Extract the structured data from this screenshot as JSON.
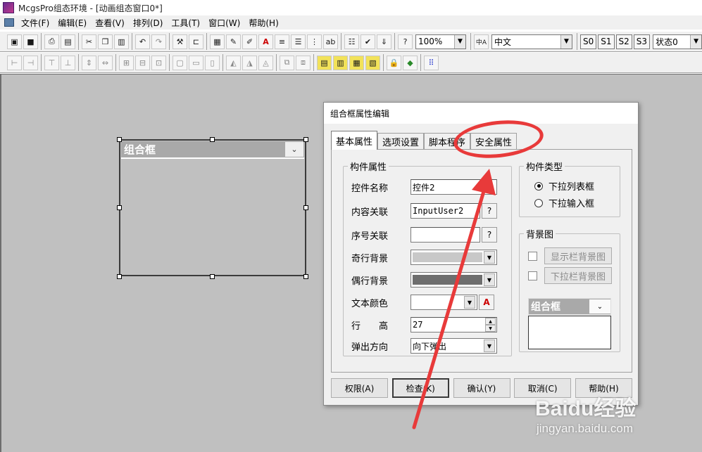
{
  "window": {
    "title": "McgsPro组态环境 - [动画组态窗口0*]"
  },
  "menu": [
    "文件(F)",
    "编辑(E)",
    "查看(V)",
    "排列(D)",
    "工具(T)",
    "窗口(W)",
    "帮助(H)"
  ],
  "toolbar": {
    "zoom_value": "100%",
    "language_value": "中文",
    "language_icon_text": "中A",
    "state_buttons": [
      "S0",
      "S1",
      "S2",
      "S3"
    ],
    "state_value": "状态0",
    "text_icon": "A"
  },
  "canvas_combo": {
    "label": "组合框"
  },
  "dialog": {
    "title": "组合框属性编辑",
    "tabs": [
      "基本属性",
      "选项设置",
      "脚本程序",
      "安全属性"
    ],
    "component_group": {
      "legend": "构件属性",
      "fields": {
        "name": {
          "label": "控件名称",
          "value": "控件2"
        },
        "content": {
          "label": "内容关联",
          "value": "InputUser2",
          "button": "?"
        },
        "index": {
          "label": "序号关联",
          "value": "",
          "button": "?"
        },
        "odd_bg": {
          "label": "奇行背景"
        },
        "even_bg": {
          "label": "偶行背景"
        },
        "text_color": {
          "label": "文本颜色"
        },
        "row_height": {
          "label": "行　　高",
          "value": "27"
        },
        "popup_dir": {
          "label": "弹出方向",
          "value": "向下弹出"
        }
      }
    },
    "type_group": {
      "legend": "构件类型",
      "options": [
        "下拉列表框",
        "下拉输入框"
      ],
      "selected": 0
    },
    "bg_group": {
      "legend": "背景图",
      "checks": [
        "显示栏背景图",
        "下拉栏背景图"
      ],
      "preview_label": "组合框"
    },
    "buttons": [
      "权限(A)",
      "检查(K)",
      "确认(Y)",
      "取消(C)",
      "帮助(H)"
    ]
  },
  "colors": {
    "odd_bg": "#c8c8c8",
    "even_bg": "#6e6e6e",
    "annotation": "#e83a3a"
  },
  "watermark": {
    "brand": "Baidu经验",
    "url": "jingyan.baidu.com"
  }
}
